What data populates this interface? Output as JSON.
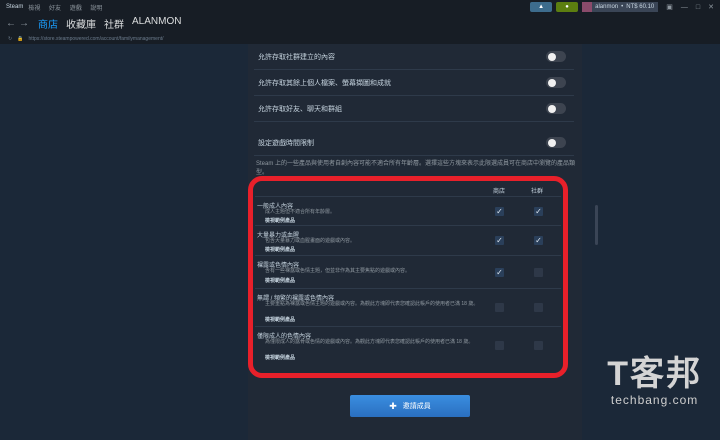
{
  "titlebar": {
    "logo": "Steam",
    "menu": [
      "檢視",
      "好友",
      "遊戲",
      "說明"
    ],
    "user": "alanmon",
    "wallet": "NT$ 60.10",
    "announce_icon": "megaphone-icon",
    "notify_icon": "bell-icon"
  },
  "nav": {
    "tabs": [
      "商店",
      "收藏庫",
      "社群",
      "ALANMON"
    ]
  },
  "url": "https://store.steampowered.com/account/familymanagement/",
  "toggles": [
    {
      "label": "允許存取社群建立的內容",
      "on": false
    },
    {
      "label": "允許存取其餘上個人檔案、螢幕擷圖和成就",
      "on": false
    },
    {
      "label": "允許存取好友、聊天和群組",
      "on": false
    },
    {
      "label": "設定遊戲時間限制",
      "on": false
    }
  ],
  "notice": "Steam 上的一些產品與使用者自創內容可能不適合所有年齡層。選擇這些方塊來表示此限選成員可在商店中瀏覽的產品類型。",
  "table": {
    "col_store": "商店",
    "col_community": "社群",
    "categories": [
      {
        "title": "一般成人內容",
        "desc": "成人主題但不適合所有年齡層。",
        "example": "檢視範例產品",
        "store": true,
        "community": true
      },
      {
        "title": "大量暴力或血腥",
        "desc": "包含大量暴力或血腥畫面的遊戲或內容。",
        "example": "檢視範例產品",
        "store": true,
        "community": true
      },
      {
        "title": "裸露或色情內容",
        "desc": "含有一些裸露或色情主題，但並非作為其主要焦點的遊戲或內容。",
        "example": "檢視範例產品",
        "store": true,
        "community": false
      },
      {
        "title": "無謂 / 頻繁的裸露或色情內容",
        "desc": "主要重點為裸露或色情主題的遊戲或內容。為觀此方塊即代表您確認此帳戶的使用者已滿 18 歲。",
        "example": "檢視範例產品",
        "store": false,
        "community": false
      },
      {
        "title": "僅限成人的色情內容",
        "desc": "為僅限成人的露骨或色情的遊戲或內容。為觀此方塊即代表您確認此帳戶的使用者已滿 18 歲。",
        "example": "檢視範例產品",
        "store": false,
        "community": false
      }
    ]
  },
  "install_button": "邀請成員",
  "watermark": {
    "big": "T客邦",
    "small": "techbang.com"
  }
}
